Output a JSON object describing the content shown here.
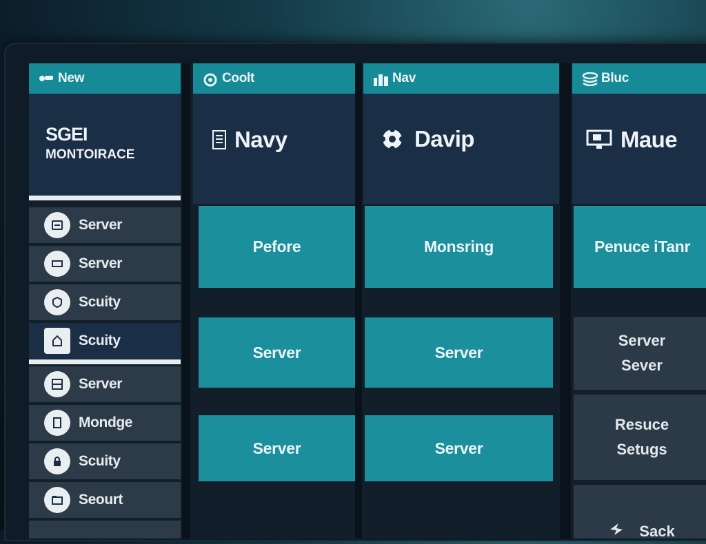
{
  "sidebar": {
    "tab": "New",
    "brand_line1": "SGEI",
    "brand_line2": "MONTOIRACE",
    "items": [
      {
        "label": "Server",
        "icon": "server-icon"
      },
      {
        "label": "Server",
        "icon": "screen-icon"
      },
      {
        "label": "Scuity",
        "icon": "shield-icon"
      },
      {
        "label": "Scuity",
        "icon": "home-icon",
        "active": true
      },
      {
        "label": "Server",
        "icon": "grid-icon"
      },
      {
        "label": "Mondge",
        "icon": "document-icon"
      },
      {
        "label": "Scuity",
        "icon": "lock-icon"
      },
      {
        "label": "Seourt",
        "icon": "folder-icon"
      }
    ]
  },
  "col1": {
    "tab": "Coolt",
    "title": "Navy",
    "tiles": [
      "Pefore",
      "Server",
      "Server"
    ]
  },
  "col2": {
    "tab": "Nav",
    "title": "Davip",
    "tiles": [
      "Monsring",
      "Server",
      "Server"
    ]
  },
  "col3": {
    "tab": "Bluc",
    "title": "Maue",
    "tile_top": "Penuce iTanr",
    "gray_tiles": [
      {
        "line1": "Server",
        "line2": "Sever"
      },
      {
        "line1": "Resuce",
        "line2": "Setugs"
      },
      {
        "line1": "Sack",
        "line2": ""
      }
    ]
  },
  "colors": {
    "accent": "#168b97",
    "tile": "#1b8f9b",
    "panel": "#1a2e45",
    "gray": "#2c3a47"
  }
}
